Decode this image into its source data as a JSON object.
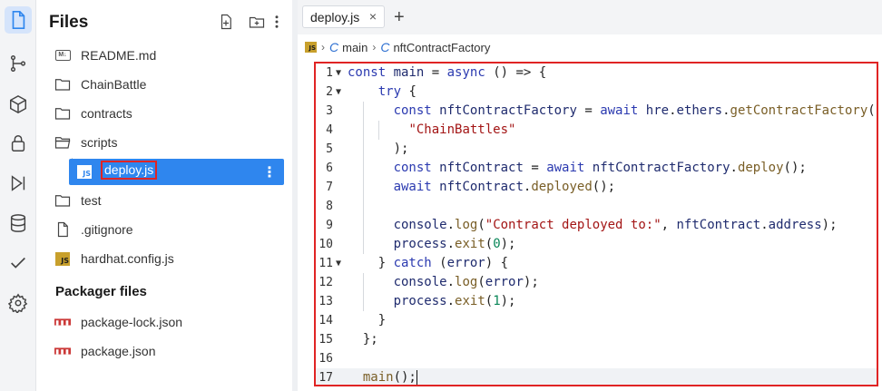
{
  "explorer": {
    "title": "Files",
    "items": [
      {
        "label": "README.md",
        "icon": "markdown-icon"
      },
      {
        "label": "ChainBattle",
        "icon": "folder-icon"
      },
      {
        "label": "contracts",
        "icon": "folder-icon"
      },
      {
        "label": "scripts",
        "icon": "folder-open-icon"
      },
      {
        "label": "deploy.js",
        "icon": "js-file-icon"
      },
      {
        "label": "test",
        "icon": "folder-icon"
      },
      {
        "label": ".gitignore",
        "icon": "file-icon"
      },
      {
        "label": "hardhat.config.js",
        "icon": "js-file-icon"
      }
    ],
    "js_badge": "JS",
    "md_badge": "M↓",
    "packager_title": "Packager files",
    "packager_items": [
      {
        "label": "package-lock.json",
        "icon": "npm-icon"
      },
      {
        "label": "package.json",
        "icon": "npm-icon"
      }
    ]
  },
  "editor": {
    "tab_label": "deploy.js",
    "tab_close": "×",
    "new_tab": "+",
    "breadcrumb": [
      "main",
      "nftContractFactory"
    ],
    "code_lines": [
      {
        "n": "1",
        "t": "const main = async () => {",
        "fold": "▼",
        "ind": 0
      },
      {
        "n": "2",
        "t": "    try {",
        "fold": "▼",
        "ind": 0
      },
      {
        "n": "3",
        "t": "      const nftContractFactory = await hre.ethers.getContractFactory(",
        "fold": "",
        "ind": 1
      },
      {
        "n": "4",
        "t": "        \"ChainBattles\"",
        "fold": "",
        "ind": 2
      },
      {
        "n": "5",
        "t": "      );",
        "fold": "",
        "ind": 1
      },
      {
        "n": "6",
        "t": "      const nftContract = await nftContractFactory.deploy();",
        "fold": "",
        "ind": 1
      },
      {
        "n": "7",
        "t": "      await nftContract.deployed();",
        "fold": "",
        "ind": 1
      },
      {
        "n": "8",
        "t": "",
        "fold": "",
        "ind": 1
      },
      {
        "n": "9",
        "t": "      console.log(\"Contract deployed to:\", nftContract.address);",
        "fold": "",
        "ind": 1
      },
      {
        "n": "10",
        "t": "      process.exit(0);",
        "fold": "",
        "ind": 1
      },
      {
        "n": "11",
        "t": "    } catch (error) {",
        "fold": "▼",
        "ind": 0
      },
      {
        "n": "12",
        "t": "      console.log(error);",
        "fold": "",
        "ind": 1
      },
      {
        "n": "13",
        "t": "      process.exit(1);",
        "fold": "",
        "ind": 1
      },
      {
        "n": "14",
        "t": "    }",
        "fold": "",
        "ind": 0
      },
      {
        "n": "15",
        "t": "  };",
        "fold": "",
        "ind": 0
      },
      {
        "n": "16",
        "t": "",
        "fold": "",
        "ind": 0
      },
      {
        "n": "17",
        "t": "  main();",
        "fold": "",
        "ind": 0
      }
    ]
  },
  "colors": {
    "accent": "#2f86ee",
    "highlight_border": "#e02424",
    "keyword": "#2b3ab0",
    "string": "#a31515",
    "number": "#098658",
    "function": "#795e26"
  }
}
